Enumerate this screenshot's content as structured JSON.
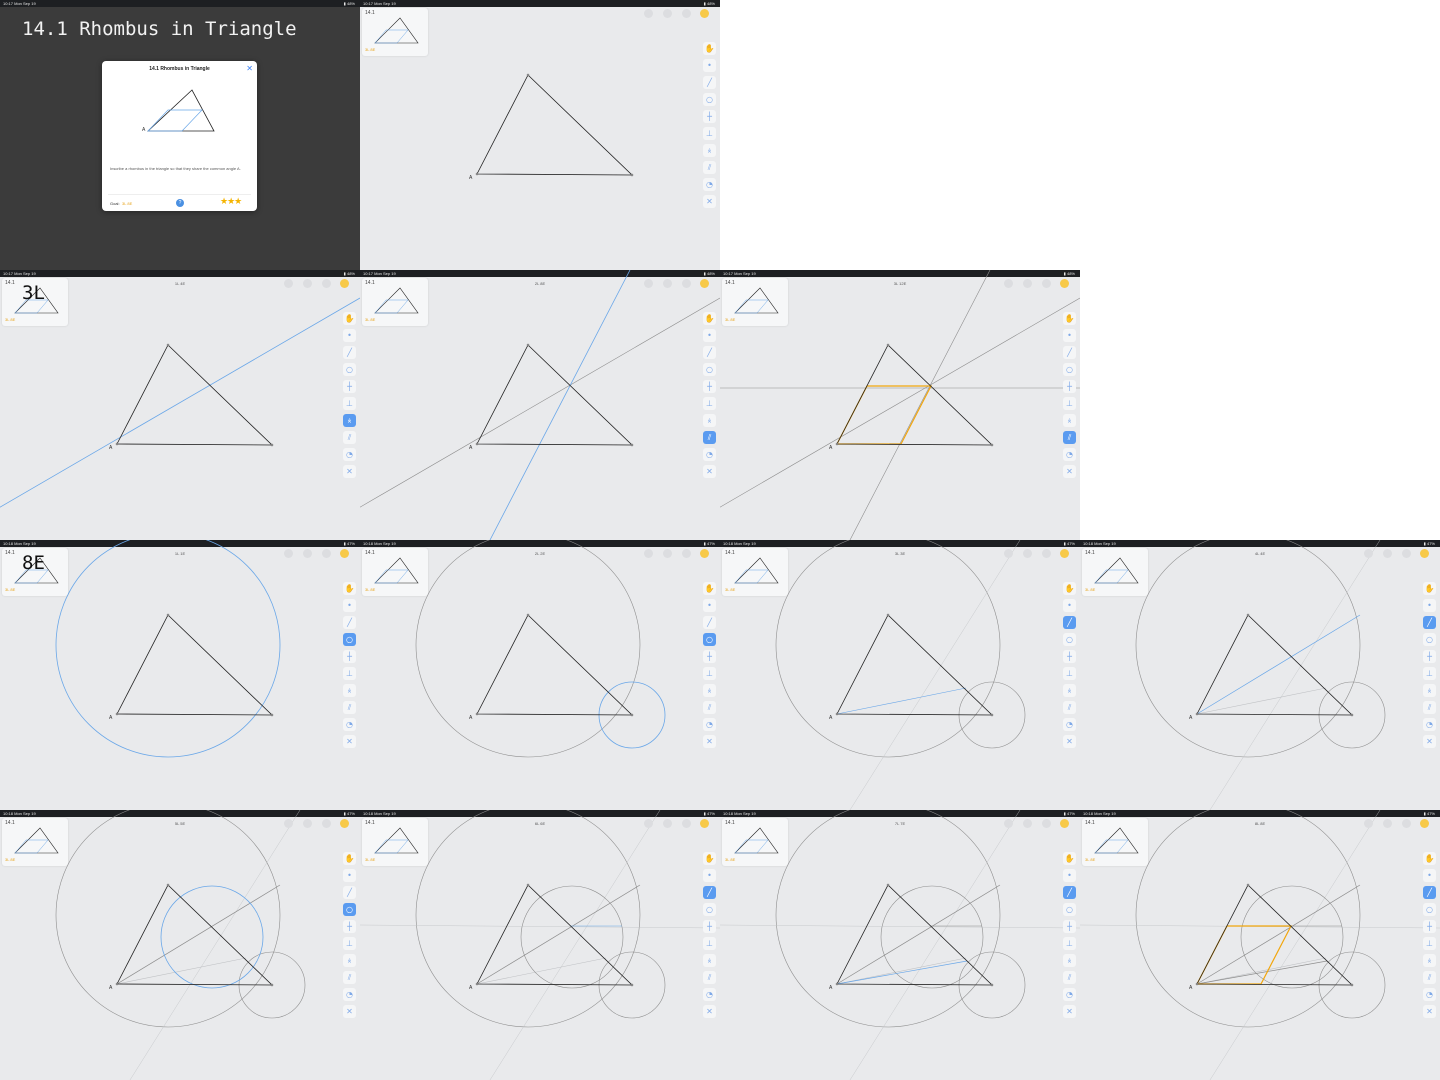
{
  "status": {
    "frames": [
      {
        "time": "10:17",
        "date": "Mon Sep 19",
        "battery": "48%"
      },
      {
        "time": "10:17",
        "date": "Mon Sep 19",
        "battery": "48%"
      },
      {
        "time": "10:17",
        "date": "Mon Sep 19",
        "battery": "48%"
      },
      {
        "time": "10:17",
        "date": "Mon Sep 19",
        "battery": "48%"
      },
      {
        "time": "10:17",
        "date": "Mon Sep 19",
        "battery": "48%"
      },
      {
        "time": "10:18",
        "date": "Mon Sep 19",
        "battery": "47%"
      },
      {
        "time": "10:18",
        "date": "Mon Sep 19",
        "battery": "47%"
      },
      {
        "time": "10:18",
        "date": "Mon Sep 19",
        "battery": "47%"
      },
      {
        "time": "10:18",
        "date": "Mon Sep 19",
        "battery": "47%"
      },
      {
        "time": "10:18",
        "date": "Mon Sep 19",
        "battery": "47%"
      },
      {
        "time": "10:18",
        "date": "Mon Sep 19",
        "battery": "47%"
      },
      {
        "time": "10:18",
        "date": "Mon Sep 19",
        "battery": "47%"
      },
      {
        "time": "10:18",
        "date": "Mon Sep 19",
        "battery": "47%"
      }
    ]
  },
  "intro": {
    "heading": "14.1 Rhombus in Triangle",
    "modal_title": "14.1 Rhombus in Triangle",
    "modal_description": "Inscribe a rhombus in the triangle so that they share the common angle A.",
    "goal_label": "Goal:",
    "goal_value": "3L 8E",
    "help": "?",
    "stars": "★★★",
    "vertex_label": "A"
  },
  "level": {
    "thumb_title": "14.1",
    "goal": "3L 8E",
    "vertex_label": "A"
  },
  "section_labels": {
    "lines": "3L",
    "euclid": "8E"
  },
  "counters": [
    "",
    "",
    "1L 4E",
    "2L 8E",
    "3L 12E",
    "1L 1E",
    "2L 2E",
    "3L 3E",
    "4L 4E",
    "5L 5E",
    "6L 6E",
    "7L 7E",
    "8L 8E"
  ],
  "colors": {
    "accent": "#5a9bf0",
    "construction": "#6aa7e8",
    "rhombus": "#f2a60c",
    "triangle": "#222222"
  },
  "toolbar_icons": [
    "hand-icon",
    "point-icon",
    "line-icon",
    "circle-icon",
    "perpendicular-bisector-icon",
    "perpendicular-icon",
    "angle-bisector-icon",
    "parallel-icon",
    "compass-icon",
    "eraser-icon"
  ]
}
